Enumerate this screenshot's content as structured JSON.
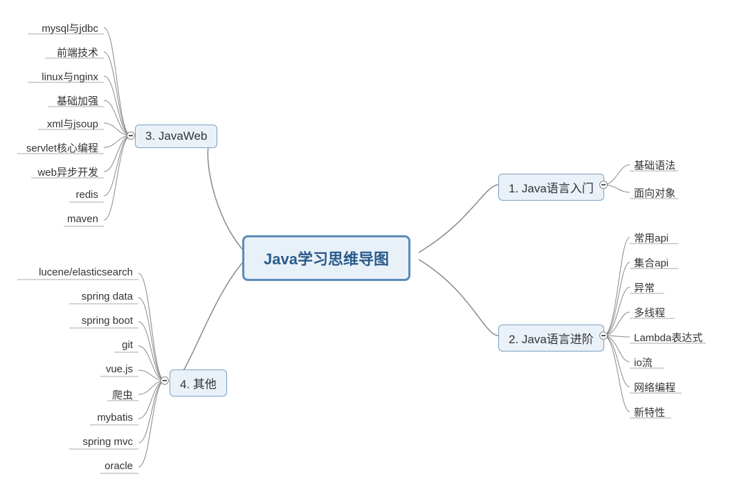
{
  "central": {
    "title": "Java学习思维导图"
  },
  "branches": {
    "b1": {
      "label": "1. Java语言入门",
      "leaves": [
        "基础语法",
        "面向对象"
      ]
    },
    "b2": {
      "label": "2. Java语言进阶",
      "leaves": [
        "常用api",
        "集合api",
        "异常",
        "多线程",
        "Lambda表达式",
        "io流",
        "网络编程",
        "新特性"
      ]
    },
    "b3": {
      "label": "3. JavaWeb",
      "leaves": [
        "mysql与jdbc",
        "前端技术",
        "linux与nginx",
        "基础加强",
        "xml与jsoup",
        "servlet核心编程",
        "web异步开发",
        "redis",
        "maven"
      ]
    },
    "b4": {
      "label": "4. 其他",
      "leaves": [
        "lucene/elasticsearch",
        "spring data",
        "spring boot",
        "git",
        "vue.js",
        "爬虫",
        "mybatis",
        "spring mvc",
        "oracle"
      ]
    }
  }
}
